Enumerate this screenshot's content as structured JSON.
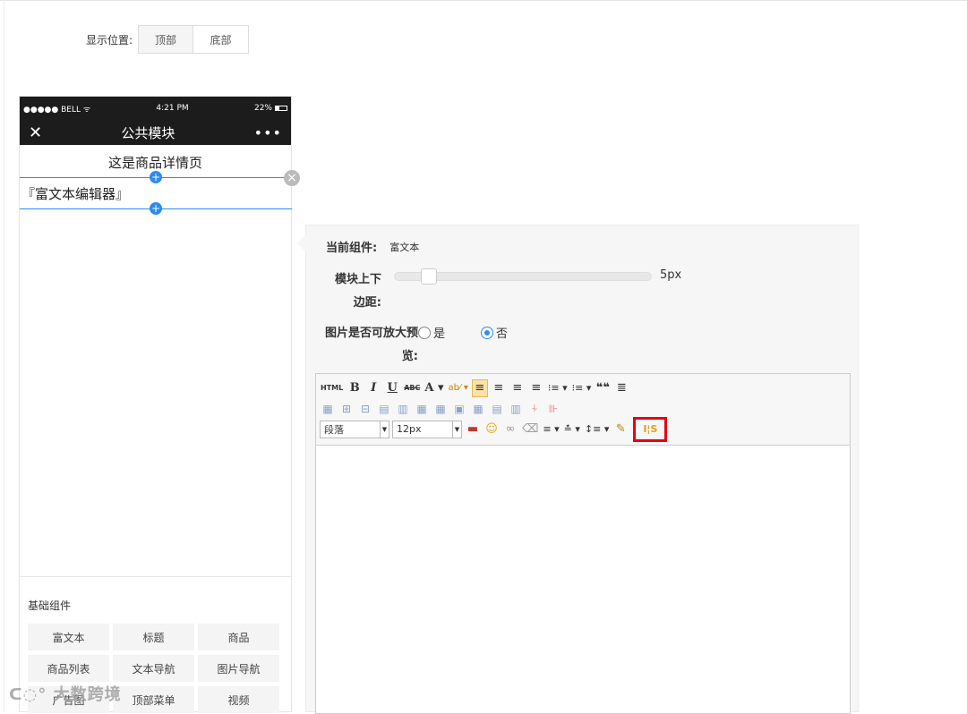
{
  "display_position": {
    "label": "显示位置:",
    "options": [
      "顶部",
      "底部"
    ],
    "selected": "顶部"
  },
  "phone": {
    "carrier": "●●●●● BELL ᯤ",
    "time": "4:21 PM",
    "battery": "22%",
    "close": "✕",
    "title": "公共模块",
    "more": "•••",
    "page_title": "这是商品详情页",
    "rich_text_placeholder": "『富文本编辑器』"
  },
  "components": {
    "title": "基础组件",
    "items": [
      "富文本",
      "标题",
      "商品",
      "商品列表",
      "文本导航",
      "图片导航",
      "广告图",
      "顶部菜单",
      "视频"
    ]
  },
  "watermark": "大数跨境",
  "properties": {
    "current_component_label": "当前组件:",
    "current_component_value": "富文本",
    "margin_label": "模块上下边距:",
    "margin_value": "5px",
    "margin_fraction": 0.1,
    "zoom_label": "图片是否可放大预览:",
    "zoom_options": [
      "是",
      "否"
    ],
    "zoom_selected": "否"
  },
  "editor": {
    "paragraph_select": "段落",
    "fontsize_select": "12px",
    "row1": [
      "HTML",
      "B",
      "I",
      "U",
      "ABC",
      "A ▾",
      "ab⁄ ▾",
      "≡",
      "≡",
      "≡",
      "≡",
      "⁝≡ ▾",
      "⁝≡ ▾",
      "❝❝",
      "≣"
    ],
    "format_icon": "I¦S"
  }
}
